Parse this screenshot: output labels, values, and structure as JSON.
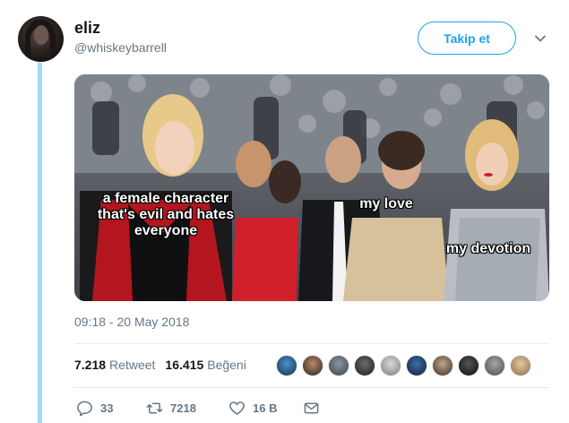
{
  "tweet": {
    "user": {
      "name": "eliz",
      "handle": "@whiskeybarrell"
    },
    "follow_label": "Takip et",
    "meme": {
      "caption_1": "a female character\nthat's evil and hates\neveryone",
      "caption_2": "my love",
      "caption_3": "my devotion"
    },
    "timestamp": "09:18 - 20 May 2018",
    "stats": {
      "retweets_count": "7.218",
      "retweets_label": "Retweet",
      "likes_count": "16.415",
      "likes_label": "Beğeni"
    },
    "likers": [
      "avatar-1",
      "avatar-2",
      "avatar-3",
      "avatar-4",
      "avatar-5",
      "avatar-6",
      "avatar-7",
      "avatar-8",
      "avatar-9",
      "avatar-10"
    ],
    "actions": {
      "replies": "33",
      "retweets": "7218",
      "likes": "16 B"
    }
  },
  "icons": {
    "follow": "follow-button",
    "caret": "chevron-down-icon",
    "reply": "reply-icon",
    "retweet": "retweet-icon",
    "like": "heart-icon",
    "dm": "envelope-icon"
  },
  "colors": {
    "accent": "#1da1f2",
    "thread_line": "#a5d8f1",
    "muted_text": "#657786",
    "text": "#14171a"
  }
}
